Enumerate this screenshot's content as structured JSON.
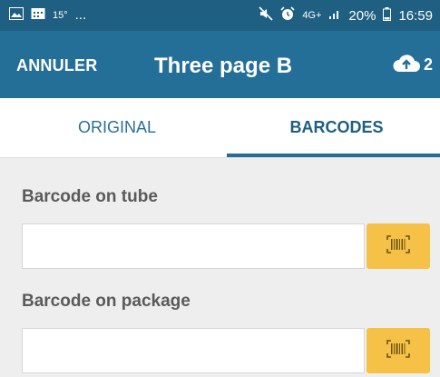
{
  "status_bar": {
    "temperature": "15°",
    "dots": "...",
    "network": "4G+",
    "battery": "20%",
    "time": "16:59"
  },
  "app_bar": {
    "cancel_label": "ANNULER",
    "title": "Three page B",
    "upload_count": "2",
    "upload_icon": "cloud-upload-icon"
  },
  "tabs": [
    {
      "label": "ORIGINAL",
      "selected": false
    },
    {
      "label": "BARCODES",
      "selected": true
    }
  ],
  "form": {
    "fields": [
      {
        "label": "Barcode on tube",
        "value": "",
        "scan_icon": "barcode-scan-icon"
      },
      {
        "label": "Barcode on package",
        "value": "",
        "scan_icon": "barcode-scan-icon"
      }
    ]
  },
  "colors": {
    "status_bar": "#1e5f82",
    "app_bar": "#246f97",
    "accent": "#f5c146",
    "background": "#eeeeee"
  }
}
